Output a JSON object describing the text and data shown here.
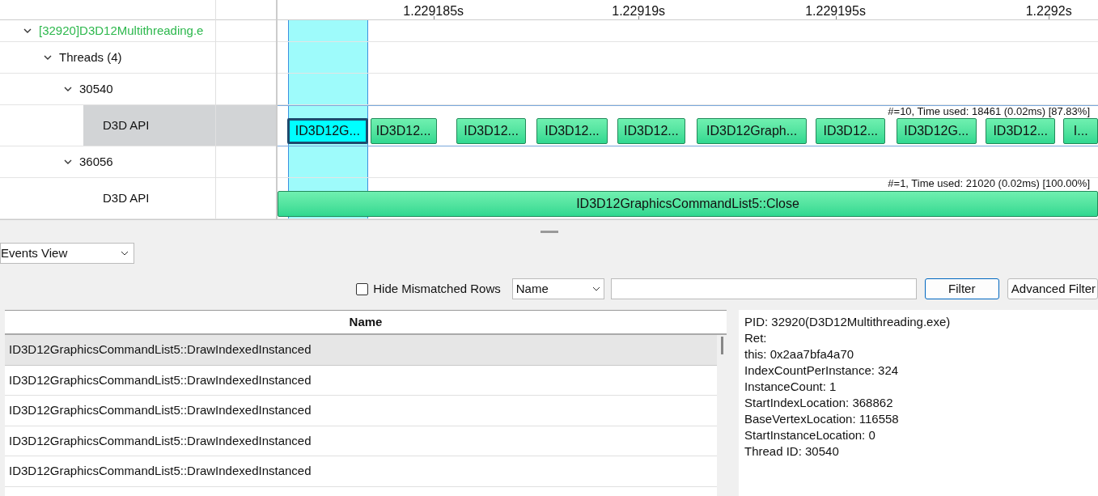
{
  "timeline": {
    "ruler_ticks": [
      "1.229185s",
      "1.22919s",
      "1.229195s",
      "1.2292s"
    ],
    "tree": [
      {
        "label": "[32920]D3D12Multithreading.e",
        "expanded": true,
        "selected": false,
        "children": [
          {
            "label": "Threads (4)",
            "expanded": true,
            "selected": false,
            "children": [
              {
                "label": "30540",
                "expanded": true,
                "selected": false,
                "children": [
                  {
                    "label": "D3D API",
                    "selected": true,
                    "summary": "#=10, Time used: 18461 (0.02ms) [87.83%]",
                    "events": [
                      {
                        "label": "ID3D12G...",
                        "selected": true
                      },
                      {
                        "label": "ID3D12...",
                        "selected": false
                      },
                      {
                        "label": "ID3D12...",
                        "selected": false
                      },
                      {
                        "label": "ID3D12...",
                        "selected": false
                      },
                      {
                        "label": "ID3D12...",
                        "selected": false
                      },
                      {
                        "label": "ID3D12Graph...",
                        "selected": false
                      },
                      {
                        "label": "ID3D12...",
                        "selected": false
                      },
                      {
                        "label": "ID3D12G...",
                        "selected": false
                      },
                      {
                        "label": "ID3D12...",
                        "selected": false
                      },
                      {
                        "label": "I...",
                        "selected": false
                      }
                    ]
                  }
                ]
              },
              {
                "label": "36056",
                "expanded": true,
                "selected": false,
                "children": [
                  {
                    "label": "D3D API",
                    "selected": false,
                    "summary": "#=1, Time used: 21020 (0.02ms) [100.00%]",
                    "events": [
                      {
                        "label": "ID3D12GraphicsCommandList5::Close",
                        "selected": false
                      }
                    ]
                  }
                ]
              }
            ]
          }
        ]
      }
    ]
  },
  "view_select": {
    "value": "Events View"
  },
  "filter_bar": {
    "hide_mismatched": {
      "label": "Hide Mismatched Rows",
      "checked": false
    },
    "field_select": {
      "value": "Name"
    },
    "buttons": [
      "Filter",
      "Advanced Filter"
    ]
  },
  "events_table": {
    "columns": [
      "Name"
    ],
    "rows": [
      {
        "name": "ID3D12GraphicsCommandList5::DrawIndexedInstanced",
        "selected": true
      },
      {
        "name": "ID3D12GraphicsCommandList5::DrawIndexedInstanced",
        "selected": false
      },
      {
        "name": "ID3D12GraphicsCommandList5::DrawIndexedInstanced",
        "selected": false
      },
      {
        "name": "ID3D12GraphicsCommandList5::DrawIndexedInstanced",
        "selected": false
      },
      {
        "name": "ID3D12GraphicsCommandList5::DrawIndexedInstanced",
        "selected": false
      }
    ]
  },
  "details": [
    "PID: 32920(D3D12Multithreading.exe)",
    "Ret:",
    "this: 0x2aa7bfa4a70",
    "IndexCountPerInstance: 324",
    "InstanceCount: 1",
    "StartIndexLocation: 368862",
    "BaseVertexLocation: 116558",
    "StartInstanceLocation: 0",
    "Thread ID: 30540"
  ]
}
